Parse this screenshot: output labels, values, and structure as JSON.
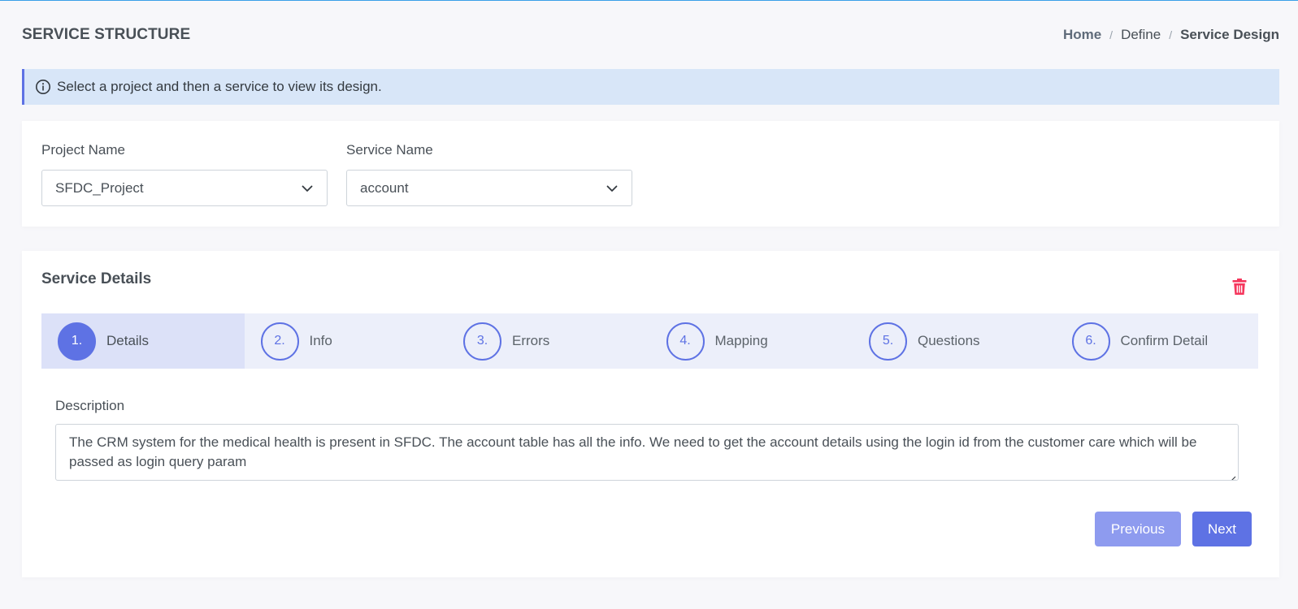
{
  "header": {
    "title": "SERVICE STRUCTURE",
    "breadcrumb": {
      "home": "Home",
      "define": "Define",
      "current": "Service Design",
      "separator": "/"
    }
  },
  "alert": {
    "icon": "info-circle-icon",
    "text": "Select a project and then a service to view its design."
  },
  "selectors": {
    "project": {
      "label": "Project Name",
      "value": "SFDC_Project"
    },
    "service": {
      "label": "Service Name",
      "value": "account"
    }
  },
  "details": {
    "title": "Service Details",
    "delete_icon": "trash-icon",
    "steps": [
      {
        "num": "1.",
        "label": "Details"
      },
      {
        "num": "2.",
        "label": "Info"
      },
      {
        "num": "3.",
        "label": "Errors"
      },
      {
        "num": "4.",
        "label": "Mapping"
      },
      {
        "num": "5.",
        "label": "Questions"
      },
      {
        "num": "6.",
        "label": "Confirm Detail"
      }
    ],
    "active_step": 1,
    "description_label": "Description",
    "description_value": "The CRM system for the medical health is present in SFDC. The account table has all the info. We need to get the account details using the login id from the customer care which will be passed as login query param",
    "previous_label": "Previous",
    "next_label": "Next"
  },
  "colors": {
    "primary": "#5e72e4",
    "primary_light": "#8e9bef",
    "alert_bg": "#d8e6f8",
    "danger": "#f5365c"
  }
}
